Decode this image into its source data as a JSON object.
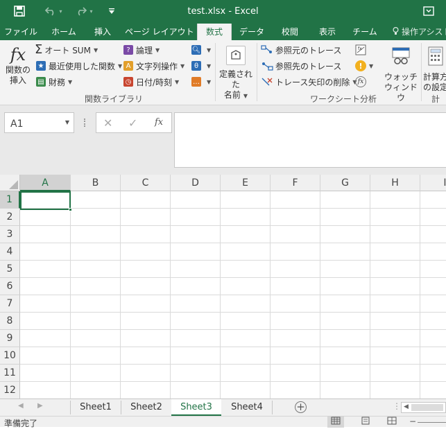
{
  "window": {
    "title": "test.xlsx - Excel"
  },
  "tabs": [
    {
      "label": "ファイル"
    },
    {
      "label": "ホーム"
    },
    {
      "label": "挿入"
    },
    {
      "label": "ページ レイアウト"
    },
    {
      "label": "数式"
    },
    {
      "label": "データ"
    },
    {
      "label": "校閲"
    },
    {
      "label": "表示"
    },
    {
      "label": "チーム"
    },
    {
      "label": "操作アシスト"
    }
  ],
  "ribbon": {
    "insert_function": {
      "line1": "関数の",
      "line2": "挿入"
    },
    "autosum": "オート SUM",
    "recent": "最近使用した関数",
    "financial": "財務",
    "logical": "論理",
    "text": "文字列操作",
    "datetime": "日付/時刻",
    "define_names": {
      "line1": "定義された",
      "line2": "名前"
    },
    "trace_precedents": "参照元のトレース",
    "trace_dependents": "参照先のトレース",
    "remove_arrows": "トレース矢印の削除",
    "watch": {
      "line1": "ウォッチ",
      "line2": "ウィンドウ"
    },
    "calc": {
      "line1": "計算方",
      "line2": "の設定"
    },
    "group_library": "関数ライブラリ",
    "group_audit": "ワークシート分析",
    "group_calc": "計算"
  },
  "formula_bar": {
    "name_box": "A1",
    "formula": ""
  },
  "columns": [
    "A",
    "B",
    "C",
    "D",
    "E",
    "F",
    "G",
    "H",
    "I"
  ],
  "rows": [
    "1",
    "2",
    "3",
    "4",
    "5",
    "6",
    "7",
    "8",
    "9",
    "10",
    "11",
    "12"
  ],
  "sheets": [
    "Sheet1",
    "Sheet2",
    "Sheet3",
    "Sheet4"
  ],
  "active_sheet": "Sheet3",
  "status": {
    "text": "準備完了"
  },
  "colors": {
    "accent": "#217346"
  }
}
